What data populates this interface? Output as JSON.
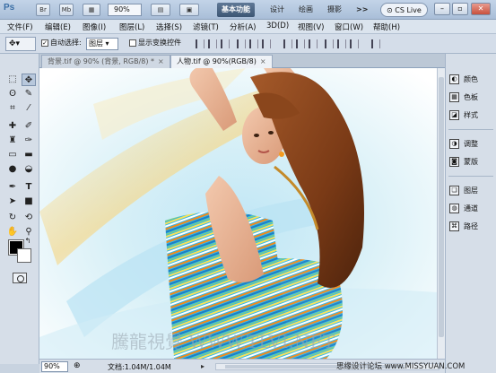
{
  "app": {
    "logo": "Ps"
  },
  "titlebar": {
    "zoom": "90%",
    "workspaces": [
      "基本功能",
      "设计",
      "绘画",
      "摄影"
    ],
    "more": ">>",
    "cslive": "CS Live"
  },
  "menubar": {
    "items": [
      "文件(F)",
      "编辑(E)",
      "图像(I)",
      "图层(L)",
      "选择(S)",
      "滤镜(T)",
      "分析(A)",
      "3D(D)",
      "视图(V)",
      "窗口(W)",
      "帮助(H)"
    ]
  },
  "options": {
    "auto_select_label": "自动选择:",
    "auto_select_value": "图层",
    "show_transform_label": "显示变换控件"
  },
  "tabs": [
    {
      "label": "背景.tif @ 90% (背景, RGB/8) *",
      "active": false
    },
    {
      "label": "人物.tif @ 90%(RGB/8)",
      "active": true
    }
  ],
  "status": {
    "zoom": "90%",
    "doc": "文档:1.04M/1.04M"
  },
  "panels": [
    {
      "icon": "color-icon",
      "label": "颜色"
    },
    {
      "icon": "swatches-icon",
      "label": "色板"
    },
    {
      "icon": "styles-icon",
      "label": "样式"
    },
    {
      "icon": "adjustments-icon",
      "label": "调整"
    },
    {
      "icon": "masks-icon",
      "label": "蒙版"
    },
    {
      "icon": "layers-icon",
      "label": "图层"
    },
    {
      "icon": "channels-icon",
      "label": "通道"
    },
    {
      "icon": "paths-icon",
      "label": "路径"
    }
  ],
  "watermark": "思缘设计论坛 www.MISSYUAN.COM",
  "canvas_watermark": "騰龍視覺 WWW.TLVI.NET"
}
